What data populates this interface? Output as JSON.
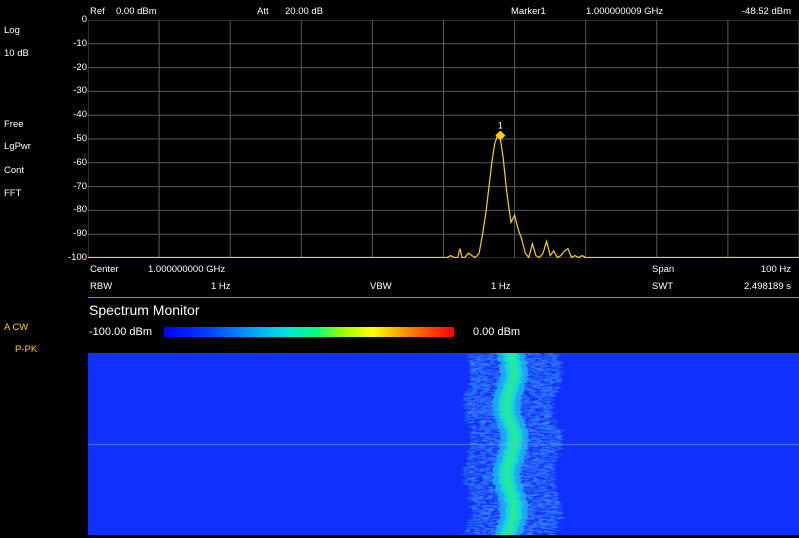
{
  "header": {
    "ref_label": "Ref",
    "ref_value": "0.00 dBm",
    "att_label": "Att",
    "att_value": "20.00 dB",
    "marker_label": "Marker1",
    "marker_freq": "1.000000009 GHz",
    "marker_level": "-48.52 dBm"
  },
  "left_panel": {
    "scale_type": "Log",
    "scale_div": "10 dB",
    "trigger": "Free",
    "detector": "LgPwr",
    "sweep": "Cont",
    "mode": "FFT",
    "trace_mode": "A CW",
    "trace_detector": "P-PK"
  },
  "plot": {
    "y_ticks": [
      "0",
      "-10",
      "-20",
      "-30",
      "-40",
      "-50",
      "-60",
      "-70",
      "-80",
      "-90",
      "-100"
    ],
    "marker_number": "1",
    "trace_color": "#ffd200",
    "grid_color": "#5a5a5a"
  },
  "chart_data": {
    "type": "line",
    "ylabel": "",
    "xlabel": "",
    "ylim": [
      -100,
      0
    ],
    "xlim": [
      0,
      100
    ],
    "series": [
      {
        "values_x": [
          0,
          50.5,
          51,
          51.5,
          52,
          52.3,
          52.6,
          53,
          53.5,
          54,
          54.5,
          55,
          55.5,
          56,
          56.4,
          56.8,
          57.2,
          57.6,
          58,
          58.4,
          58.8,
          59.2,
          59.5,
          60,
          60.5,
          61,
          61.5,
          62,
          62.5,
          63,
          63.5,
          64,
          64.5,
          65,
          65.5,
          66,
          66.5,
          67,
          67.5,
          68,
          68.5,
          69,
          69.5,
          70,
          100
        ],
        "values_y": [
          -100,
          -100,
          -99,
          -100,
          -100,
          -96,
          -100,
          -100,
          -98,
          -99,
          -100,
          -98,
          -90,
          -80,
          -70,
          -60,
          -52,
          -48.5,
          -50,
          -58,
          -70,
          -79,
          -85,
          -82,
          -88,
          -92,
          -98,
          -100,
          -94,
          -99,
          -100,
          -98,
          -93,
          -99,
          -97,
          -100,
          -99,
          -97,
          -96,
          -100,
          -99,
          -100,
          -99,
          -100,
          -100
        ]
      }
    ],
    "marker": {
      "x": 58,
      "y": -48.52
    }
  },
  "footer": {
    "center_label": "Center",
    "center_value": "1.000000000 GHz",
    "span_label": "Span",
    "span_value": "100 Hz",
    "rbw_label": "RBW",
    "rbw_value": "1 Hz",
    "vbw_label": "VBW",
    "vbw_value": "1 Hz",
    "swt_label": "SWT",
    "swt_value": "2.498189 s"
  },
  "monitor": {
    "title": "Spectrum Monitor",
    "scale_min": "-100.00 dBm",
    "scale_max": "0.00 dBm",
    "signal_position": 0.594
  }
}
